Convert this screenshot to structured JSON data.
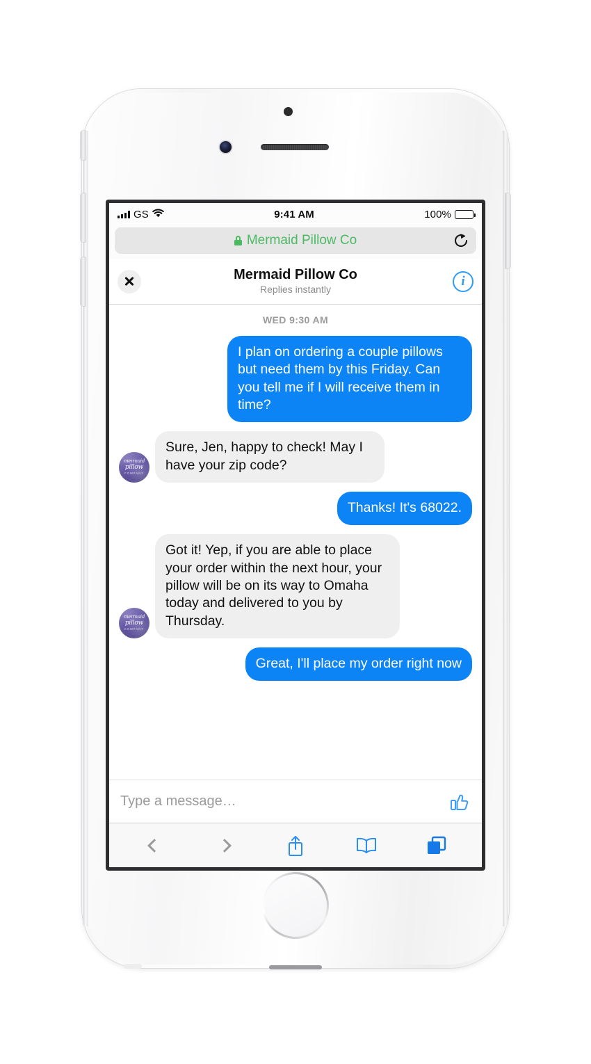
{
  "device": {
    "name": "iphone-white-silver",
    "hardware_icons": [
      "front-camera",
      "proximity-sensor",
      "earpiece-speaker",
      "home-button",
      "silent-switch",
      "volume-up-button",
      "volume-down-button",
      "power-button"
    ]
  },
  "status_bar": {
    "carrier": "GS",
    "signal_icon": "signal-bars-icon",
    "wifi_icon": "wifi-icon",
    "time": "9:41 AM",
    "battery_percent": "100%",
    "battery_icon": "battery-full-icon"
  },
  "browser": {
    "url_lock_icon": "lock-icon",
    "url_text": "Mermaid Pillow Co",
    "url_color": "#4cb963",
    "reload_icon": "reload-icon",
    "toolbar": {
      "back_icon": "chevron-left-icon",
      "forward_icon": "chevron-right-icon",
      "share_icon": "share-icon",
      "bookmarks_icon": "book-icon",
      "tabs_icon": "tabs-icon",
      "accent_color": "#0c84f5"
    }
  },
  "conversation_header": {
    "close_icon": "close-icon",
    "title": "Mermaid Pillow Co",
    "subtitle": "Replies instantly",
    "info_icon": "info-icon",
    "info_label": "i"
  },
  "thread": {
    "timestamp": "WED 9:30 AM",
    "avatar": {
      "line1": "mermaid",
      "line2": "pillow",
      "line3": "COMPANY",
      "color": "#6f62ad"
    },
    "messages": [
      {
        "side": "out",
        "text": "I plan on ordering a couple pillows but need them by this Friday. Can you tell me if I will receive them in time?",
        "has_avatar": false
      },
      {
        "side": "in",
        "text": "Sure, Jen, happy to check! May I have your zip code?",
        "has_avatar": true
      },
      {
        "side": "out",
        "text": "Thanks! It's 68022.",
        "has_avatar": false
      },
      {
        "side": "in",
        "text": "Got it! Yep, if you are able to place your order within the next hour, your pillow will be on its way to Omaha today and delivered to you by Thursday.",
        "has_avatar": true
      },
      {
        "side": "out",
        "text": "Great, I'll place my order right now",
        "has_avatar": false
      }
    ],
    "bubble_out_color": "#0c84f5",
    "bubble_in_color": "#efefef"
  },
  "composer": {
    "placeholder": "Type a message…",
    "value": "",
    "thumb_icon": "thumbs-up-icon"
  }
}
